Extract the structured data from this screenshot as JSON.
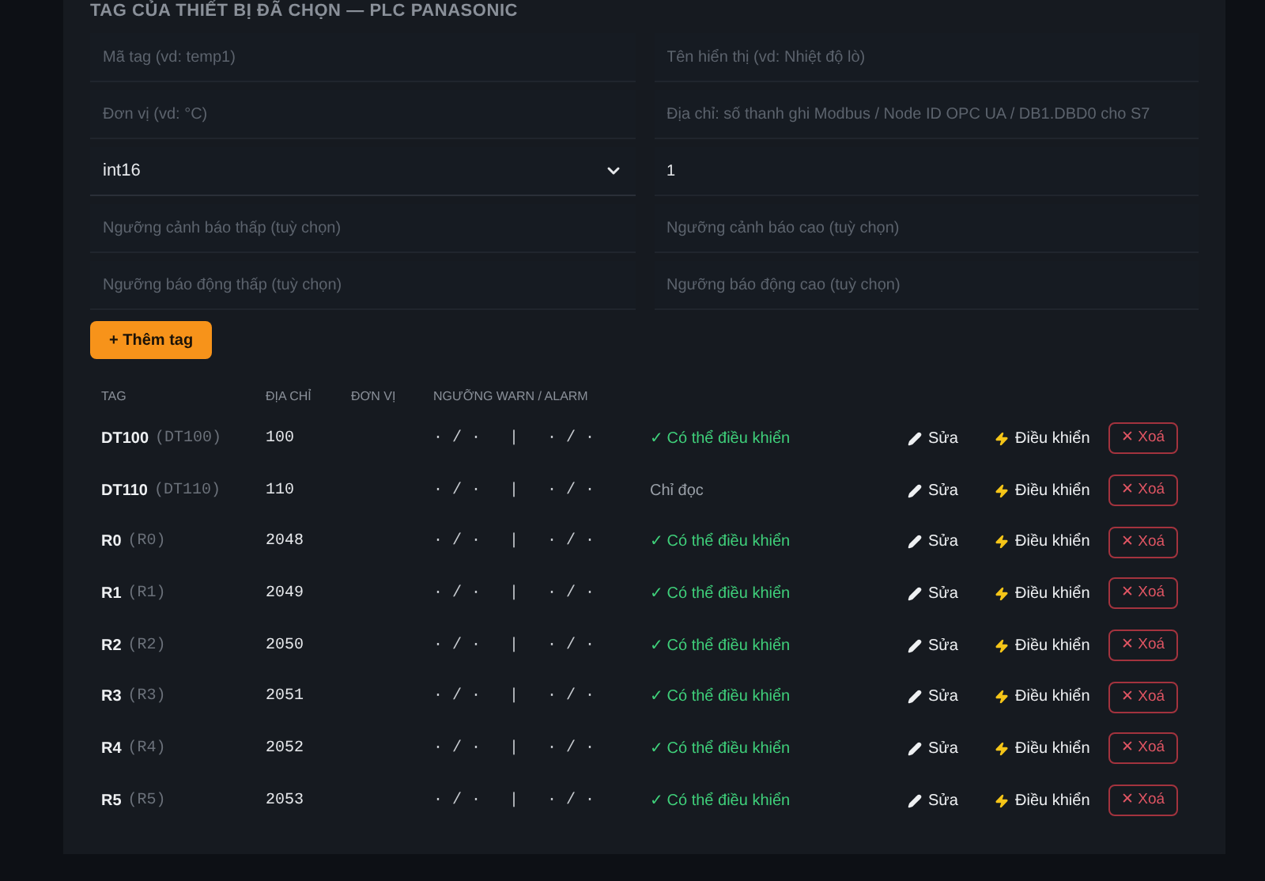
{
  "section_title": "TAG CỦA THIẾT BỊ ĐÃ CHỌN — PLC  PANASONIC",
  "form": {
    "fields": [
      {
        "kind": "input",
        "placeholder": "Mã tag (vd: temp1)"
      },
      {
        "kind": "input",
        "placeholder": "Tên hiển thị (vd: Nhiệt độ lò)"
      },
      {
        "kind": "input",
        "placeholder": "Đơn vị (vd: °C)"
      },
      {
        "kind": "input",
        "placeholder": "Địa chỉ: số thanh ghi Modbus / Node ID OPC UA / DB1.DBD0 cho S7"
      },
      {
        "kind": "select",
        "value": "int16"
      },
      {
        "kind": "input",
        "value": "1"
      },
      {
        "kind": "input",
        "placeholder": "Ngưỡng cảnh báo thấp (tuỳ chọn)"
      },
      {
        "kind": "input",
        "placeholder": "Ngưỡng cảnh báo cao (tuỳ chọn)"
      },
      {
        "kind": "input",
        "placeholder": "Ngưỡng báo động thấp (tuỳ chọn)"
      },
      {
        "kind": "input",
        "placeholder": "Ngưỡng báo động cao (tuỳ chọn)"
      }
    ],
    "add_button": "+ Thêm tag"
  },
  "table": {
    "columns": [
      "TAG",
      "ĐỊA CHỈ",
      "ĐƠN VỊ",
      "NGƯỠNG WARN / ALARM"
    ],
    "rows": [
      {
        "tag": "DT100",
        "code": "(DT100)",
        "address": "100",
        "thresholds": "· / ·   |   · / ·",
        "controllable": true,
        "status": "✓ Có thể điều khiển",
        "edit": "Sửa",
        "control": "Điều khiển",
        "delete": "✕ Xoá"
      },
      {
        "tag": "DT110",
        "code": "(DT110)",
        "address": "110",
        "thresholds": "· / ·   |   · / ·",
        "controllable": false,
        "status": "Chỉ đọc",
        "edit": "Sửa",
        "control": "Điều khiển",
        "delete": "✕ Xoá"
      },
      {
        "tag": "R0",
        "code": "(R0)",
        "address": "2048",
        "thresholds": "· / ·   |   · / ·",
        "controllable": true,
        "status": "✓ Có thể điều khiển",
        "edit": "Sửa",
        "control": "Điều khiển",
        "delete": "✕ Xoá"
      },
      {
        "tag": "R1",
        "code": "(R1)",
        "address": "2049",
        "thresholds": "· / ·   |   · / ·",
        "controllable": true,
        "status": "✓ Có thể điều khiển",
        "edit": "Sửa",
        "control": "Điều khiển",
        "delete": "✕ Xoá"
      },
      {
        "tag": "R2",
        "code": "(R2)",
        "address": "2050",
        "thresholds": "· / ·   |   · / ·",
        "controllable": true,
        "status": "✓ Có thể điều khiển",
        "edit": "Sửa",
        "control": "Điều khiển",
        "delete": "✕ Xoá"
      },
      {
        "tag": "R3",
        "code": "(R3)",
        "address": "2051",
        "thresholds": "· / ·   |   · / ·",
        "controllable": true,
        "status": "✓ Có thể điều khiển",
        "edit": "Sửa",
        "control": "Điều khiển",
        "delete": "✕ Xoá"
      },
      {
        "tag": "R4",
        "code": "(R4)",
        "address": "2052",
        "thresholds": "· / ·   |   · / ·",
        "controllable": true,
        "status": "✓ Có thể điều khiển",
        "edit": "Sửa",
        "control": "Điều khiển",
        "delete": "✕ Xoá"
      },
      {
        "tag": "R5",
        "code": "(R5)",
        "address": "2053",
        "thresholds": "· / ·   |   · / ·",
        "controllable": true,
        "status": "✓ Có thể điều khiển",
        "edit": "Sửa",
        "control": "Điều khiển",
        "delete": "✕ Xoá"
      }
    ]
  }
}
